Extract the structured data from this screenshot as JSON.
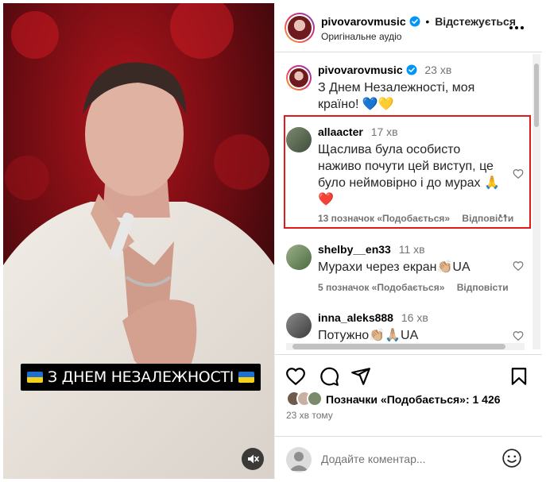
{
  "video": {
    "caption": "З ДНЕМ НЕЗАЛЕЖНОСТІ",
    "caption_flag": "ukraine-flag-icon",
    "mute_icon": "speaker-muted-icon"
  },
  "header": {
    "username": "pivovarovmusic",
    "verified_icon": "verified-badge-icon",
    "separator": "•",
    "follow_status": "Відстежується",
    "audio": "Оригінальне аудіо"
  },
  "caption_post": {
    "username": "pivovarovmusic",
    "time": "23 хв",
    "text": "З Днем Незалежності, моя країно! 💙💛"
  },
  "comments": [
    {
      "username": "allaacter",
      "time": "17 хв",
      "text": "Щаслива була особисто наживо почути цей виступ, це було неймовірно і до мурах 🙏❤️",
      "likes": "13 позначок «Подобається»",
      "reply": "Відповісти",
      "highlighted": true
    },
    {
      "username": "shelby__en33",
      "time": "11 хв",
      "text": "Мурахи через екран👏🏼UA",
      "likes": "5 позначок «Подобається»",
      "reply": "Відповісти"
    },
    {
      "username": "inna_aleks888",
      "time": "16 хв",
      "text": "Потужно👏🏼🙏🏼UA",
      "likes": "",
      "reply": ""
    }
  ],
  "actions": {
    "like_icon": "heart-icon",
    "comment_icon": "comment-icon",
    "share_icon": "share-icon",
    "save_icon": "bookmark-icon"
  },
  "likes_summary": {
    "label": "Позначки «Подобається»",
    "count": "1 426"
  },
  "posted_ago": "23 хв тому",
  "add_comment": {
    "placeholder": "Додайте коментар...",
    "emoji_icon": "smiley-icon"
  },
  "colors": {
    "highlight_border": "#e01a1a",
    "verified": "#0095f6",
    "meta_gray": "#737373"
  }
}
